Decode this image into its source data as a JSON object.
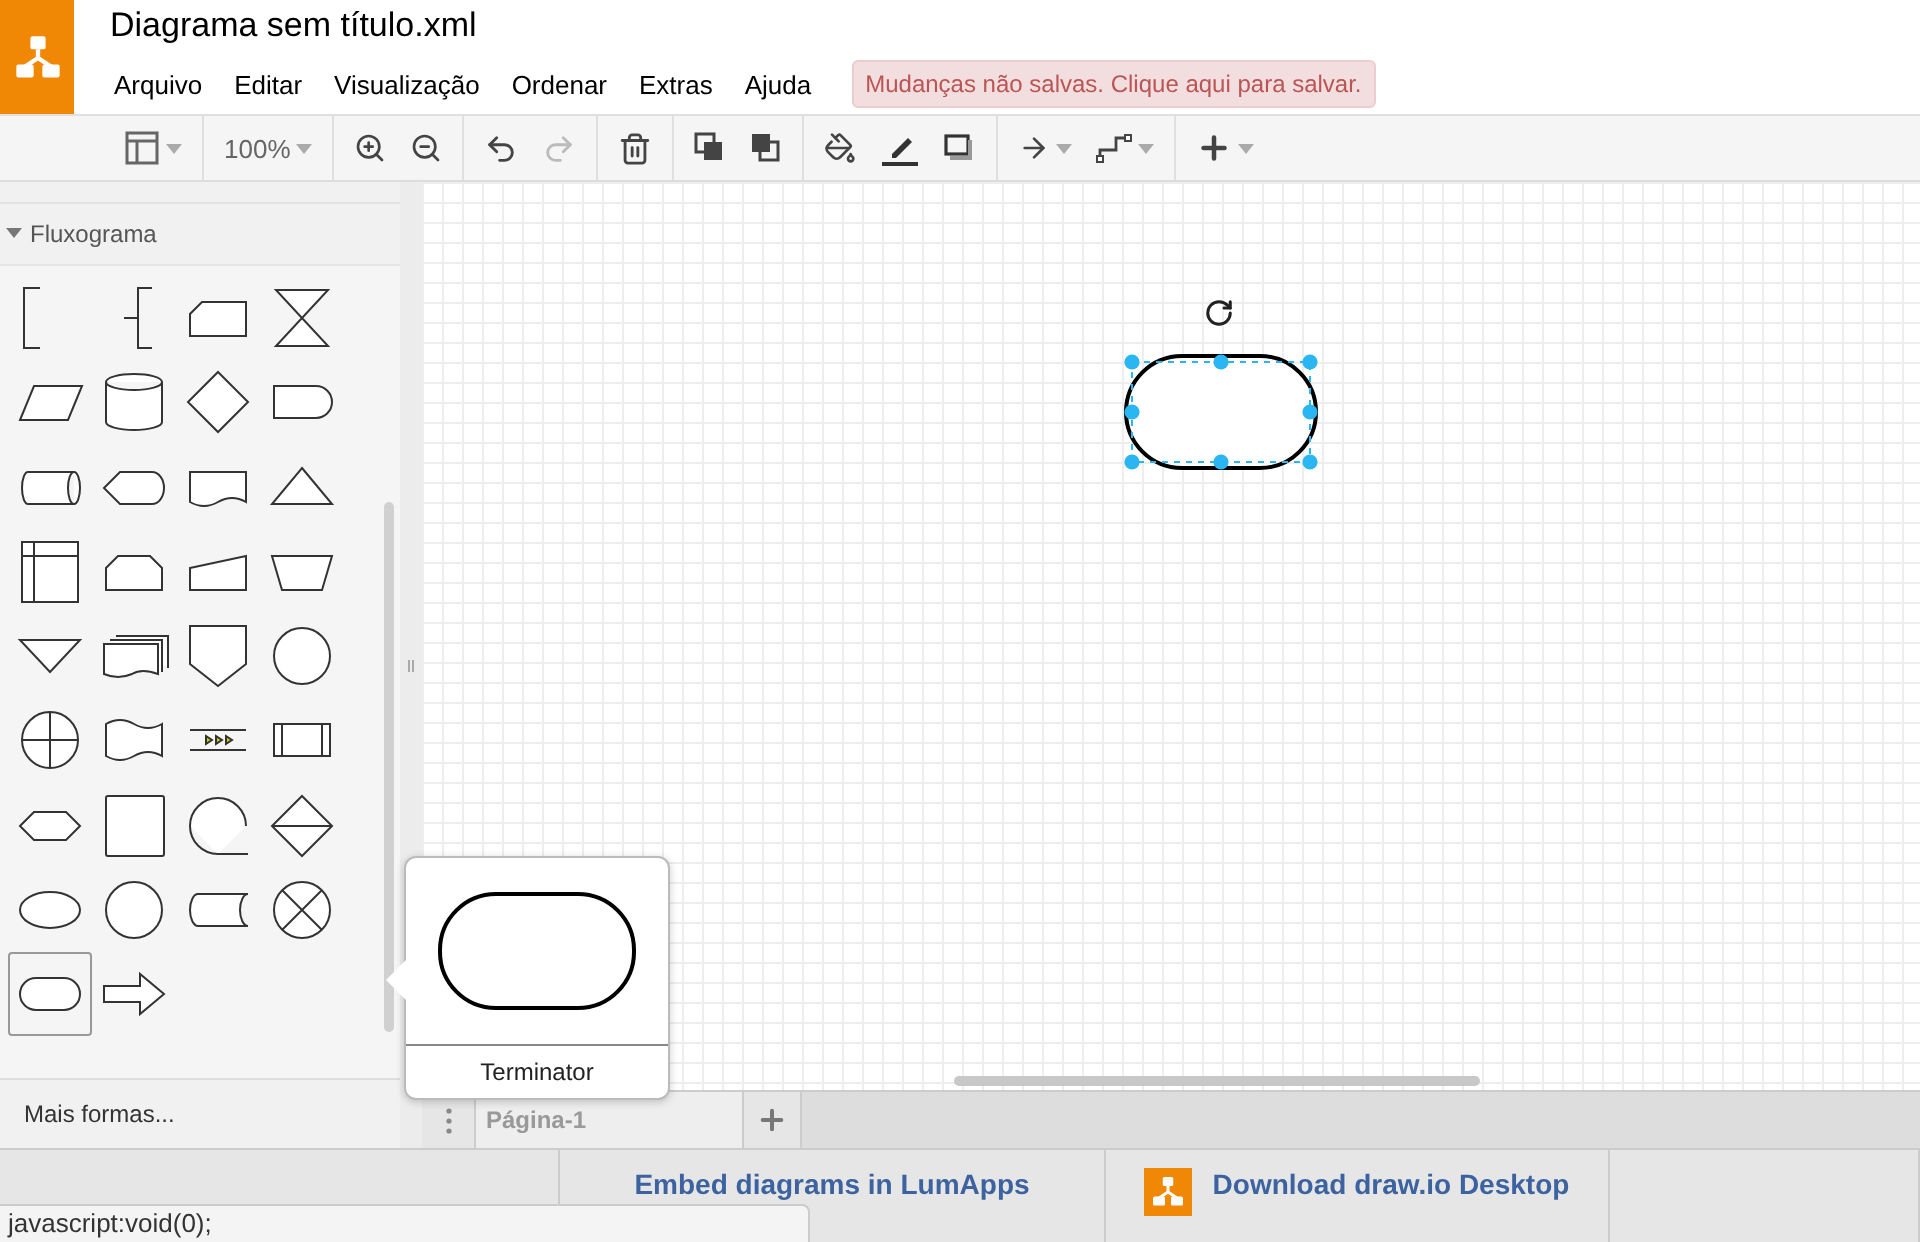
{
  "app": {
    "title": "Diagrama sem título.xml"
  },
  "menu": [
    {
      "label": "Arquivo"
    },
    {
      "label": "Editar"
    },
    {
      "label": "Visualização"
    },
    {
      "label": "Ordenar"
    },
    {
      "label": "Extras"
    },
    {
      "label": "Ajuda"
    }
  ],
  "save_notice": "Mudanças não salvas. Clique aqui para salvar.",
  "toolbar": {
    "zoom": "100%"
  },
  "sidebar": {
    "section": {
      "label": "Fluxograma",
      "expanded": true
    },
    "shapes": [
      {
        "kind": "annotation",
        "selected": false
      },
      {
        "kind": "annotation2",
        "selected": false
      },
      {
        "kind": "card",
        "selected": false
      },
      {
        "kind": "collate",
        "selected": false
      },
      {
        "kind": "parallelogram",
        "selected": false
      },
      {
        "kind": "cylinder",
        "selected": false
      },
      {
        "kind": "rhombus",
        "selected": false
      },
      {
        "kind": "delay",
        "selected": false
      },
      {
        "kind": "direct-data",
        "selected": false
      },
      {
        "kind": "display",
        "selected": false
      },
      {
        "kind": "document",
        "selected": false
      },
      {
        "kind": "triangle",
        "selected": false
      },
      {
        "kind": "internal-storage",
        "selected": false
      },
      {
        "kind": "loop-limit",
        "selected": false
      },
      {
        "kind": "manual-input",
        "selected": false
      },
      {
        "kind": "manual-operation",
        "selected": false
      },
      {
        "kind": "merge",
        "selected": false
      },
      {
        "kind": "multi-document",
        "selected": false
      },
      {
        "kind": "off-page",
        "selected": false
      },
      {
        "kind": "circle",
        "selected": false
      },
      {
        "kind": "or",
        "selected": false
      },
      {
        "kind": "tape",
        "selected": false
      },
      {
        "kind": "dots",
        "selected": false
      },
      {
        "kind": "predefined",
        "selected": false
      },
      {
        "kind": "preparation",
        "selected": false
      },
      {
        "kind": "square",
        "selected": false
      },
      {
        "kind": "sequential",
        "selected": false
      },
      {
        "kind": "sort",
        "selected": false
      },
      {
        "kind": "ellipse",
        "selected": false
      },
      {
        "kind": "circle",
        "selected": false
      },
      {
        "kind": "stored-data",
        "selected": false
      },
      {
        "kind": "summing",
        "selected": false
      },
      {
        "kind": "terminator",
        "selected": true
      },
      {
        "kind": "arrow",
        "selected": false
      }
    ],
    "more_shapes": "Mais formas..."
  },
  "canvas": {
    "shapes": [
      {
        "kind": "terminator",
        "selected": true
      }
    ]
  },
  "tooltip": {
    "label": "Terminator"
  },
  "pages": [
    {
      "label": "Página-1",
      "selected": true
    }
  ],
  "footer": [
    {
      "label": "Embed diagrams in LumApps",
      "kind": "link"
    },
    {
      "label": "Download draw.io Desktop",
      "kind": "download"
    }
  ],
  "status_text": "javascript:void(0);"
}
